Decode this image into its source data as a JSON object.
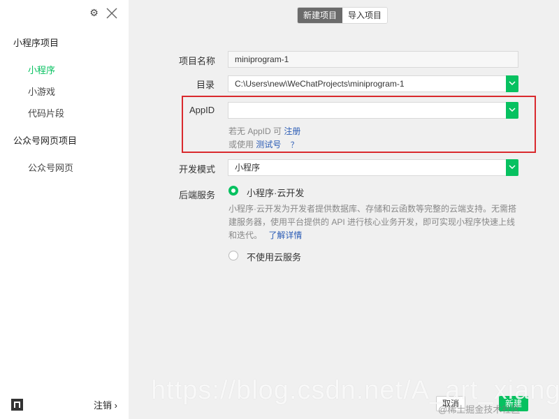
{
  "sidebar": {
    "sections": [
      {
        "title": "小程序项目",
        "items": [
          "小程序",
          "小游戏",
          "代码片段"
        ]
      },
      {
        "title": "公众号网页项目",
        "items": [
          "公众号网页"
        ]
      }
    ],
    "logout_label": "注销 ›"
  },
  "tabs": [
    "新建项目",
    "导入项目"
  ],
  "form": {
    "name_label": "项目名称",
    "name_value": "miniprogram-1",
    "dir_label": "目录",
    "dir_value": "C:\\Users\\new\\WeChatProjects\\miniprogram-1",
    "appid_label": "AppID",
    "appid_value": "",
    "appid_hint_prefix": "若无 AppID 可",
    "appid_register_link": "注册",
    "appid_test_prefix": "或使用",
    "appid_test_link": "测试号",
    "appid_help": "？",
    "mode_label": "开发模式",
    "mode_value": "小程序",
    "backend_label": "后端服务",
    "backend_option_cloud": "小程序·云开发",
    "backend_cloud_desc": "小程序·云开发为开发者提供数据库、存储和云函数等完整的云端支持。无需搭建服务器，使用平台提供的 API 进行核心业务开发，即可实现小程序快速上线和迭代。",
    "backend_cloud_link": "了解详情",
    "backend_option_none": "不使用云服务"
  },
  "footer": {
    "cancel_label": "取消",
    "create_label": "新建"
  },
  "watermark": {
    "url": "https://blog.csdn.net/A_art_xiang",
    "community": "@稀土掘金技术社区"
  },
  "colors": {
    "accent": "#07c160",
    "highlight": "#d9292d",
    "link": "#2a5bb5"
  }
}
